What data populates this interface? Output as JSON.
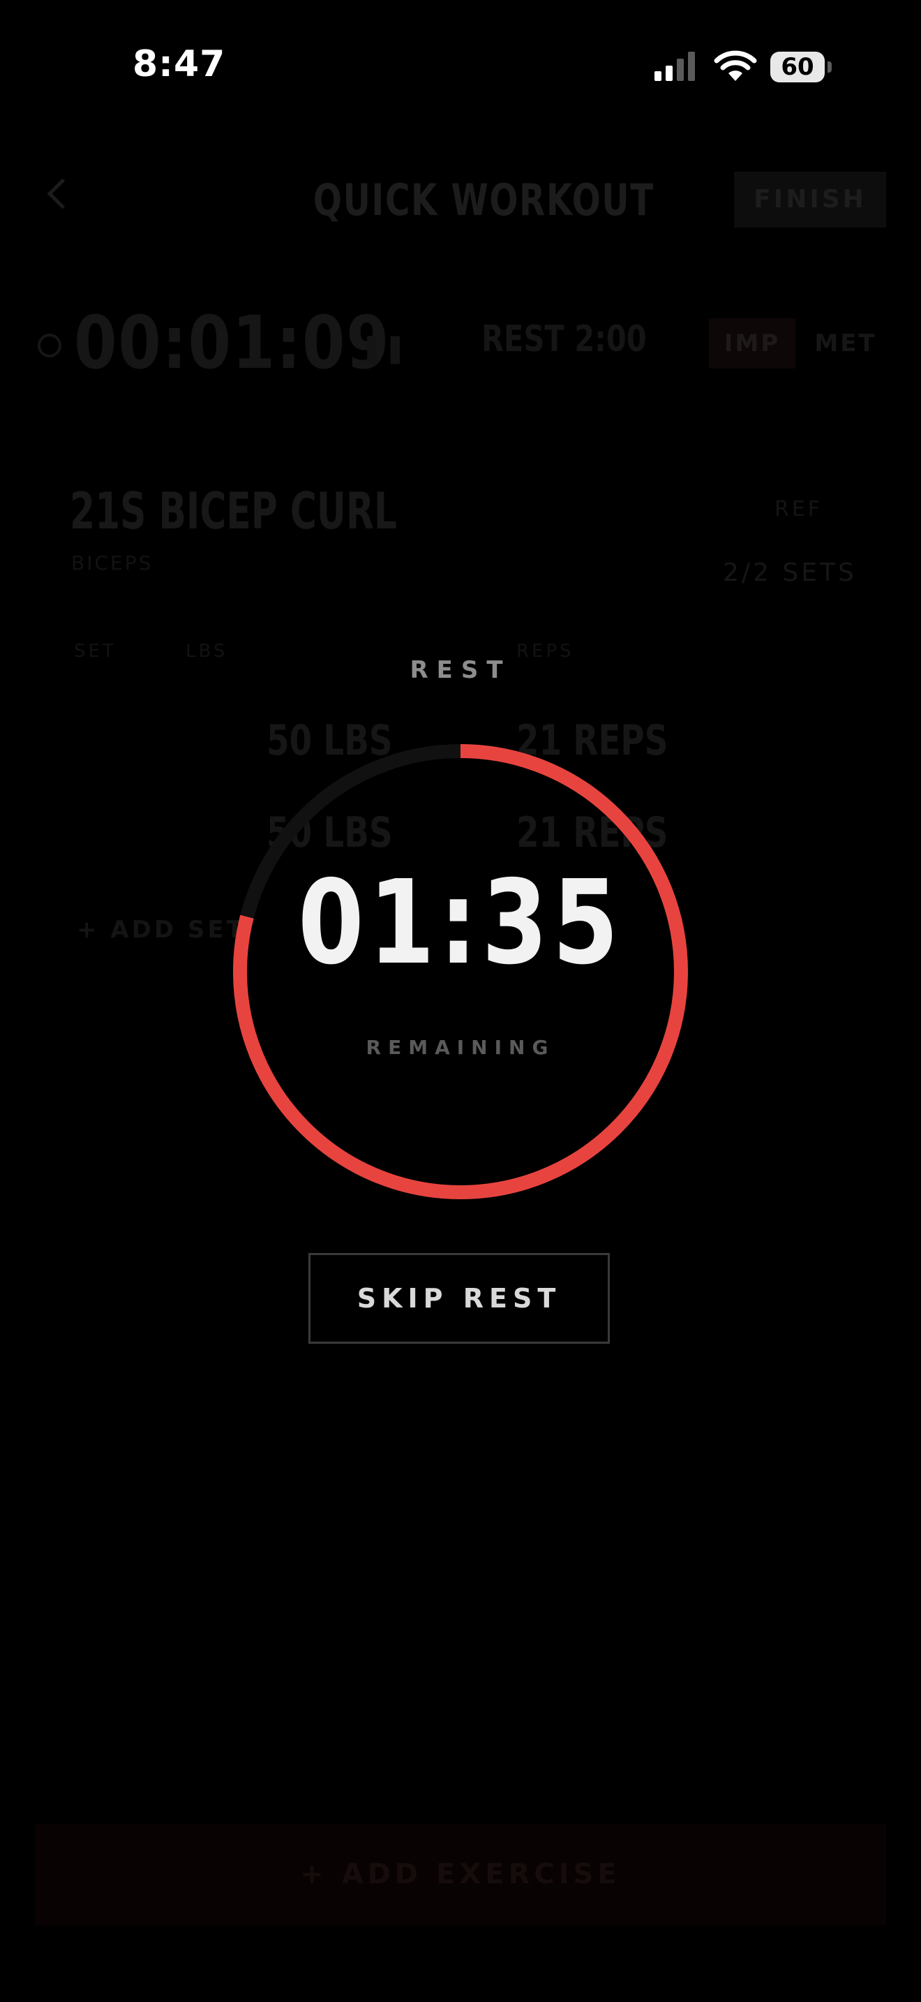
{
  "status_bar": {
    "time": "8:47",
    "battery": "60"
  },
  "workout": {
    "title": "QUICK WORKOUT",
    "finish_label": "FINISH",
    "elapsed": "00:01:09",
    "rest_setting": "REST 2:00",
    "unit_imp": "IMP",
    "unit_met": "MET",
    "exercise": {
      "name": "21S BICEP CURL",
      "sub": "BICEPS",
      "ref": "REF",
      "sets": "2/2 SETS"
    },
    "columns": [
      "SET",
      "LBS",
      "REPS"
    ],
    "rows": [
      {
        "weight": "50 LBS",
        "reps": "21 REPS"
      },
      {
        "weight": "50 LBS",
        "reps": "21 REPS"
      }
    ],
    "add_set_label": "+ ADD SET",
    "add_exercise_label": "+ ADD EXERCISE"
  },
  "rest_overlay": {
    "title": "REST",
    "countdown": "01:35",
    "remaining_label": "REMAINING",
    "skip_label": "SKIP REST",
    "progress_remaining": 0.79,
    "colors": {
      "progress": "#e8443f",
      "track": "#111111"
    }
  }
}
